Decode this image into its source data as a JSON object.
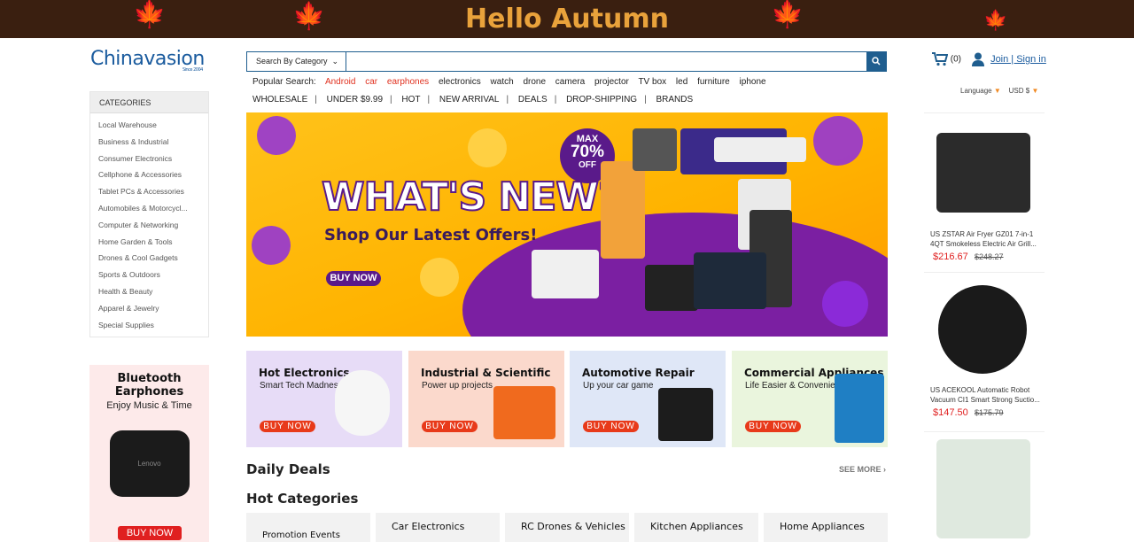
{
  "top_banner": {
    "title": "Hello Autumn"
  },
  "brand": {
    "logo_text": "Chinavasion",
    "since": "Since 2004"
  },
  "search": {
    "category_label": "Search By Category",
    "placeholder": ""
  },
  "popular": {
    "label": "Popular Search:",
    "items": [
      "Android",
      "car",
      "earphones",
      "electronics",
      "watch",
      "drone",
      "camera",
      "projector",
      "TV box",
      "led",
      "furniture",
      "iphone"
    ]
  },
  "nav": [
    "WHOLESALE",
    "UNDER $9.99",
    "HOT",
    "NEW ARRIVAL",
    "DEALS",
    "DROP-SHIPPING",
    "BRANDS"
  ],
  "cart": {
    "count": "(0)"
  },
  "account": {
    "login_label": "Join | Sign in"
  },
  "selectors": {
    "language": "Language",
    "currency": "USD $"
  },
  "categories": {
    "header": "CATEGORIES",
    "items": [
      "Local Warehouse",
      "Business & Industrial",
      "Consumer Electronics",
      "Cellphone & Accessories",
      "Tablet PCs & Accessories",
      "Automobiles & Motorcycl...",
      "Computer & Networking",
      "Home Garden & Tools",
      "Drones & Cool Gadgets",
      "Sports & Outdoors",
      "Health & Beauty",
      "Apparel & Jewelry",
      "Special Supplies"
    ]
  },
  "promo_side": {
    "title": "Bluetooth Earphones",
    "subtitle": "Enjoy Music & Time",
    "brand": "Lenovo",
    "button": "BUY NOW"
  },
  "hero": {
    "headline": "WHAT'S NEW?",
    "subline": "Shop Our Latest Offers!",
    "button": "BUY NOW",
    "badge_top": "MAX",
    "badge_value": "70%",
    "badge_bottom": "OFF"
  },
  "feature_cards": [
    {
      "title": "Hot Electronics",
      "subtitle": "Smart Tech Madness",
      "button": "BUY NOW",
      "bg": "#e7dcf7"
    },
    {
      "title": "Industrial & Scientific",
      "subtitle": "Power up projects",
      "button": "BUY NOW",
      "bg": "#fbd9cc"
    },
    {
      "title": "Automotive Repair",
      "subtitle": "Up your car game",
      "button": "BUY NOW",
      "bg": "#dfe7f7"
    },
    {
      "title": "Commercial Appliances",
      "subtitle": "Life Easier & Convenient",
      "button": "BUY NOW",
      "bg": "#eaf5dd"
    }
  ],
  "sections": {
    "daily_deals": "Daily Deals",
    "see_more": "SEE MORE",
    "hot_categories": "Hot Categories"
  },
  "hot_tabs": [
    "Promotion Events",
    "Car Electronics",
    "RC Drones & Vehicles",
    "Kitchen Appliances",
    "Home Appliances"
  ],
  "right_products": [
    {
      "name": "US ZSTAR Air Fryer GZ01 7-in-1 4QT Smokeless Electric Air Grill...",
      "price": "$216.67",
      "old_price": "$248.27"
    },
    {
      "name": "US ACEKOOL Automatic Robot Vacuum CI1 Smart Strong Suctio...",
      "price": "$147.50",
      "old_price": "$175.79"
    },
    {
      "name": "",
      "price": "",
      "old_price": ""
    }
  ],
  "colors": {
    "brand_blue": "#1f5e8f",
    "accent_red": "#e02020",
    "hero_yellow": "#ffb300",
    "hero_purple": "#5a1a8a"
  }
}
